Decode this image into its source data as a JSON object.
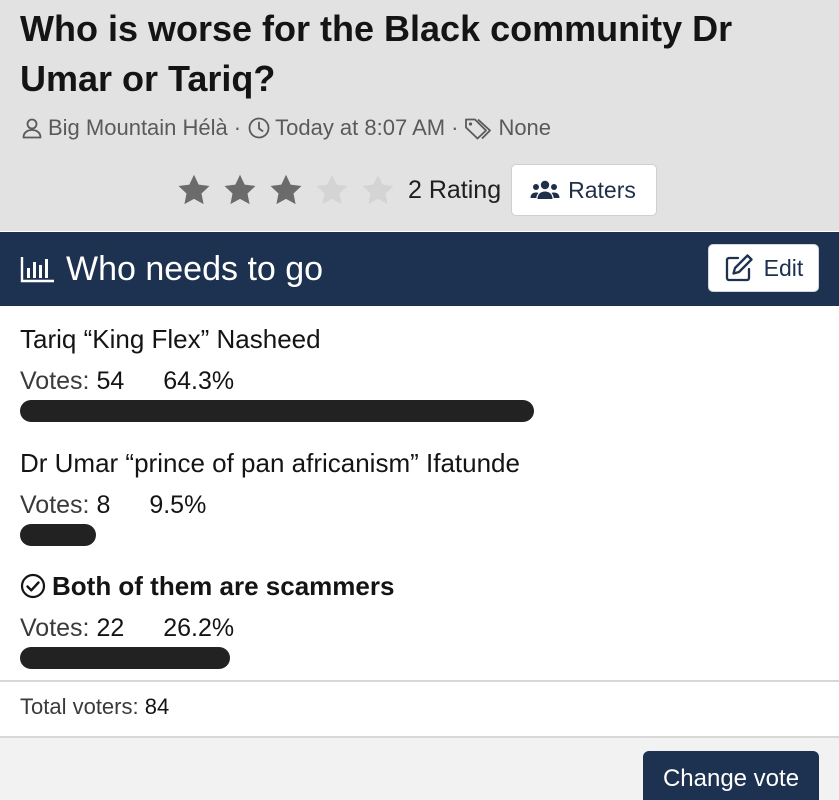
{
  "thread": {
    "title": "Who is worse for the Black community Dr Umar or Tariq?",
    "author": "Big Mountain Hélà",
    "time": "Today at 8:07 AM",
    "tags": "None"
  },
  "rating": {
    "stars_filled": 3,
    "stars_total": 5,
    "count_label": "2 Rating",
    "raters_label": "Raters"
  },
  "poll": {
    "title": "Who needs to go",
    "edit_label": "Edit",
    "votes_label": "Votes:",
    "options": [
      {
        "label": "Tariq “King Flex” Nasheed",
        "votes": "54",
        "percent": "64.3%",
        "fraction": 0.643,
        "voted": false
      },
      {
        "label": "Dr Umar “prince of pan africanism” Ifatunde",
        "votes": "8",
        "percent": "9.5%",
        "fraction": 0.095,
        "voted": false
      },
      {
        "label": "Both of them are scammers",
        "votes": "22",
        "percent": "26.2%",
        "fraction": 0.262,
        "voted": true
      }
    ],
    "total_label": "Total voters:",
    "total_value": "84",
    "change_vote_label": "Change vote"
  },
  "colors": {
    "header_bg": "#e2e2e2",
    "poll_header_bg": "#1d3150",
    "star_filled": "#6b6b6b",
    "star_empty": "#d4d4d4",
    "bar_fill": "#222222"
  },
  "icons": {
    "author": "user-icon",
    "time": "clock-icon",
    "tags": "tag-icon",
    "raters": "users-icon",
    "poll": "bar-chart-icon",
    "edit": "edit-icon",
    "voted": "check-circle-icon"
  }
}
